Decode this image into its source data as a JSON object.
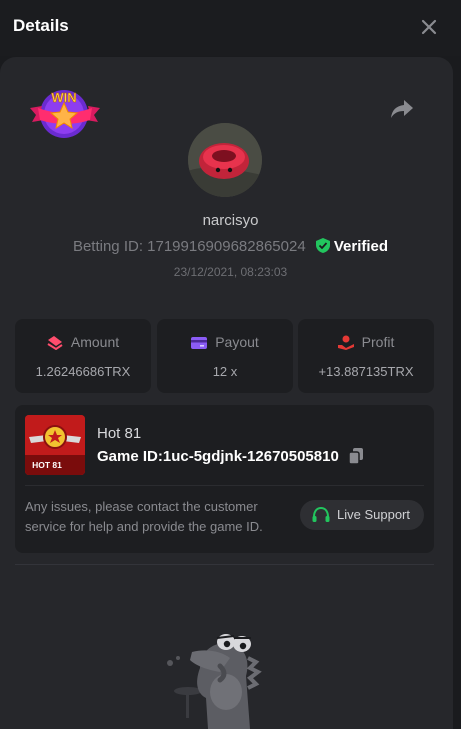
{
  "header": {
    "title": "Details"
  },
  "badge": {
    "text": "WIN"
  },
  "user": {
    "name": "narcisyo",
    "betting_id": "Betting ID: 1719916909682865024",
    "verified": "Verified",
    "datetime": "23/12/2021, 08:23:03"
  },
  "stats": [
    {
      "label": "Amount",
      "value": "1.26246686TRX",
      "icon": "amount-icon",
      "color": "#ff4d6d"
    },
    {
      "label": "Payout",
      "value": "12 x",
      "icon": "payout-card-icon",
      "color": "#8b5cf6"
    },
    {
      "label": "Profit",
      "value": "+13.887135TRX",
      "icon": "profit-icon",
      "color": "#e53935"
    }
  ],
  "game": {
    "name": "Hot 81",
    "thumb_text": "HOT 81",
    "id_label": "Game ID:",
    "id_value": "1uc-5gdjnk-12670505810"
  },
  "support": {
    "text": "Any issues, please contact the customer service for help and provide the game ID.",
    "button": "Live Support",
    "accent": "#22c55e"
  },
  "colors": {
    "background": "#1a1b1e",
    "panel": "#26272b",
    "card": "#1d1e21",
    "verified_green": "#22c55e"
  }
}
